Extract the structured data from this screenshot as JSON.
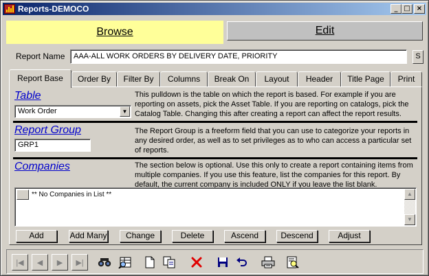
{
  "window": {
    "title": "Reports-DEMOCO",
    "minimize": "_",
    "maximize": "□",
    "close": "×"
  },
  "mode_tabs": {
    "browse": "Browse",
    "edit": "Edit"
  },
  "report_name": {
    "label": "Report Name",
    "value": "AAA-ALL WORK ORDERS BY DELIVERY DATE, PRIORITY",
    "button": "S"
  },
  "tabs": [
    "Report Base",
    "Order By",
    "Filter By",
    "Columns",
    "Break On",
    "Layout",
    "Header",
    "Title Page",
    "Print"
  ],
  "table_section": {
    "title": "Table",
    "selected": "Work Order",
    "description": "This pulldown is the table on which the report is based.  For example if you are reporting on assets, pick the Asset Table.  If you are reporting on catalogs, pick the Catalog Table.  Changing this after creating a report can affect the report results."
  },
  "group_section": {
    "title": "Report Group",
    "value": "GRP1",
    "description": "The Report Group is a freeform field that you can use to categorize your reports in any desired order, as well as to set privileges as to who can access a particular set of reports."
  },
  "companies_section": {
    "title": "Companies",
    "description": "The section below is optional.  Use this only to create a report containing items from multiple companies.  If you use this feature, list the companies for this report.  By default, the current company is included ONLY if you leave the list blank.",
    "list_items": [
      "** No Companies in List **"
    ]
  },
  "action_buttons": [
    "Add",
    "Add Many",
    "Change",
    "Delete",
    "Ascend",
    "Descend",
    "Adjust"
  ],
  "toolbar_icons": [
    "first-record-icon",
    "previous-record-icon",
    "next-record-icon",
    "last-record-icon",
    "find-icon",
    "query-icon",
    "new-icon",
    "copy-icon",
    "delete-icon",
    "save-icon",
    "undo-icon",
    "print-icon",
    "print-preview-icon"
  ],
  "colors": {
    "title_bar": "#0a246a",
    "browse_tab": "#ffff99",
    "section_title": "#0000cc",
    "window": "#d4d0c8"
  }
}
